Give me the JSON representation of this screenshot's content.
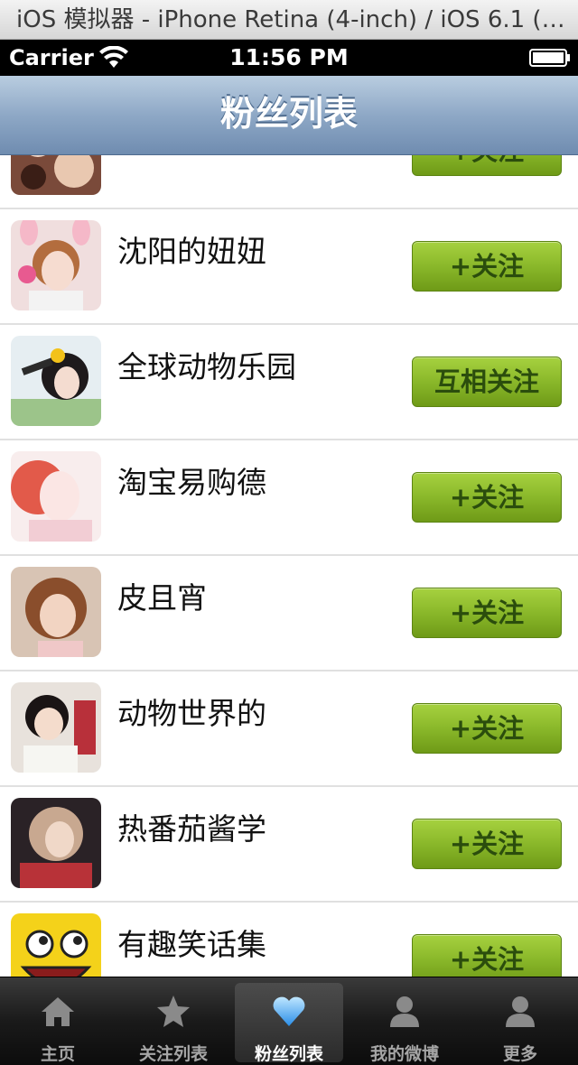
{
  "window_title": "iOS 模拟器 - iPhone Retina (4-inch) / iOS 6.1 (…",
  "status_bar": {
    "carrier": "Carrier",
    "time": "11:56 PM"
  },
  "nav": {
    "title": "粉丝列表"
  },
  "rows": [
    {
      "name": "",
      "button": "+关注"
    },
    {
      "name": "沈阳的妞妞",
      "button": "+关注"
    },
    {
      "name": "全球动物乐园",
      "button": "互相关注"
    },
    {
      "name": "淘宝易购德",
      "button": "+关注"
    },
    {
      "name": "皮且宵",
      "button": "+关注"
    },
    {
      "name": "动物世界的",
      "button": "+关注"
    },
    {
      "name": "热番茄酱学",
      "button": "+关注"
    },
    {
      "name": "有趣笑话集",
      "button": "+关注"
    }
  ],
  "tabs": [
    {
      "label": "主页",
      "icon": "home-icon"
    },
    {
      "label": "关注列表",
      "icon": "star-icon"
    },
    {
      "label": "粉丝列表",
      "icon": "heart-icon",
      "selected": true
    },
    {
      "label": "我的微博",
      "icon": "person-icon"
    },
    {
      "label": "更多",
      "icon": "person-icon"
    }
  ],
  "colors": {
    "nav_bar": "#8ea8c6",
    "button_green": "#8ab82a",
    "tab_bar": "#1a1a1a",
    "selected_icon": "#5aa8f0"
  }
}
